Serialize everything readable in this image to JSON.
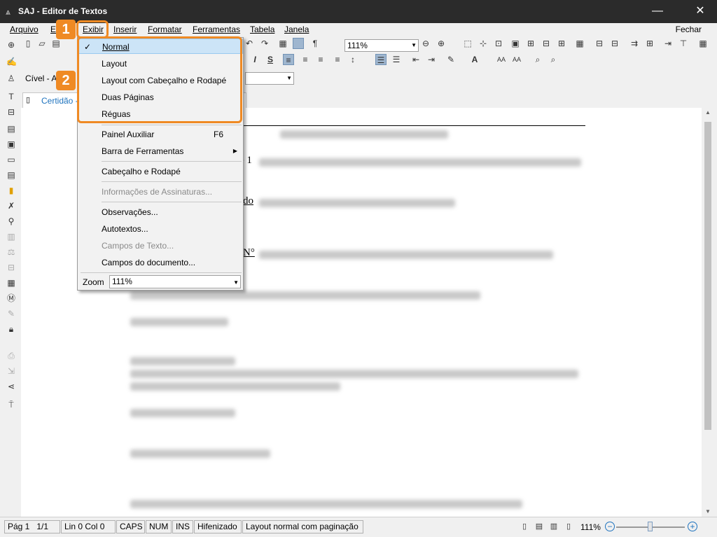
{
  "window": {
    "title": "SAJ - Editor de Textos",
    "minimize_icon": "minimize-icon",
    "close_icon": "close-icon"
  },
  "menubar": {
    "items": [
      "Arquivo",
      "Editar",
      "Exibir",
      "Inserir",
      "Formatar",
      "Ferramentas",
      "Tabela",
      "Janela"
    ],
    "right_label": "Fechar"
  },
  "toolbar": {
    "zoom_value": "111%"
  },
  "style_bar": {
    "style_label": "Cível - A"
  },
  "document_tab": {
    "label": "Certidão -"
  },
  "document": {
    "visible_fragments": [
      "e 1",
      "do",
      "N°"
    ]
  },
  "exibir_menu": {
    "items": [
      {
        "label": "Normal",
        "checked": true
      },
      {
        "label": "Layout"
      },
      {
        "label": "Layout com Cabeçalho e Rodapé"
      },
      {
        "label": "Duas Páginas"
      },
      {
        "label": "Réguas"
      },
      {
        "label": "Painel Auxiliar",
        "shortcut": "F6"
      },
      {
        "label": "Barra de Ferramentas",
        "submenu": true
      },
      {
        "label": "Cabeçalho e Rodapé"
      },
      {
        "label": "Informações de Assinaturas...",
        "disabled": true
      },
      {
        "label": "Observações..."
      },
      {
        "label": "Autotextos..."
      },
      {
        "label": "Campos de Texto...",
        "disabled": true
      },
      {
        "label": "Campos do documento..."
      }
    ],
    "zoom_label": "Zoom",
    "zoom_value": "111%"
  },
  "annotations": {
    "badge1": "1",
    "badge2": "2",
    "color": "#ef8a24"
  },
  "statusbar": {
    "page": "Pág 1",
    "page_count": "1/1",
    "line_col": "Lin 0  Col 0",
    "caps": "CAPS",
    "num": "NUM",
    "ins": "INS",
    "hyphen": "Hifenizado",
    "layout_mode": "Layout normal com paginação",
    "zoom_value": "111%"
  }
}
